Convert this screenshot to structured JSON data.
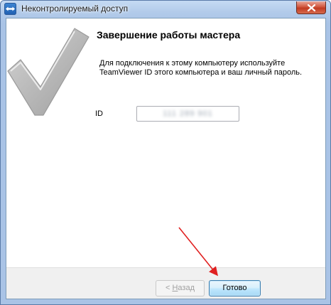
{
  "window": {
    "title": "Неконтролируемый доступ"
  },
  "wizard": {
    "heading": "Завершение работы мастера",
    "description": "Для подключения к этому компьютеру используйте TeamViewer ID этого компьютера и ваш личный пароль.",
    "id_label": "ID",
    "id_value": "111 289 901"
  },
  "buttons": {
    "back_prefix": "< ",
    "back_hotkey": "Н",
    "back_rest": "азад",
    "finish_label": "Готово"
  },
  "icons": {
    "app": "teamviewer-icon",
    "close": "close-icon",
    "checkmark": "checkmark-icon",
    "annotation": "red-arrow-icon"
  },
  "colors": {
    "accent": "#3c7fb1",
    "annotation": "#e02020",
    "close": "#c13b22"
  }
}
